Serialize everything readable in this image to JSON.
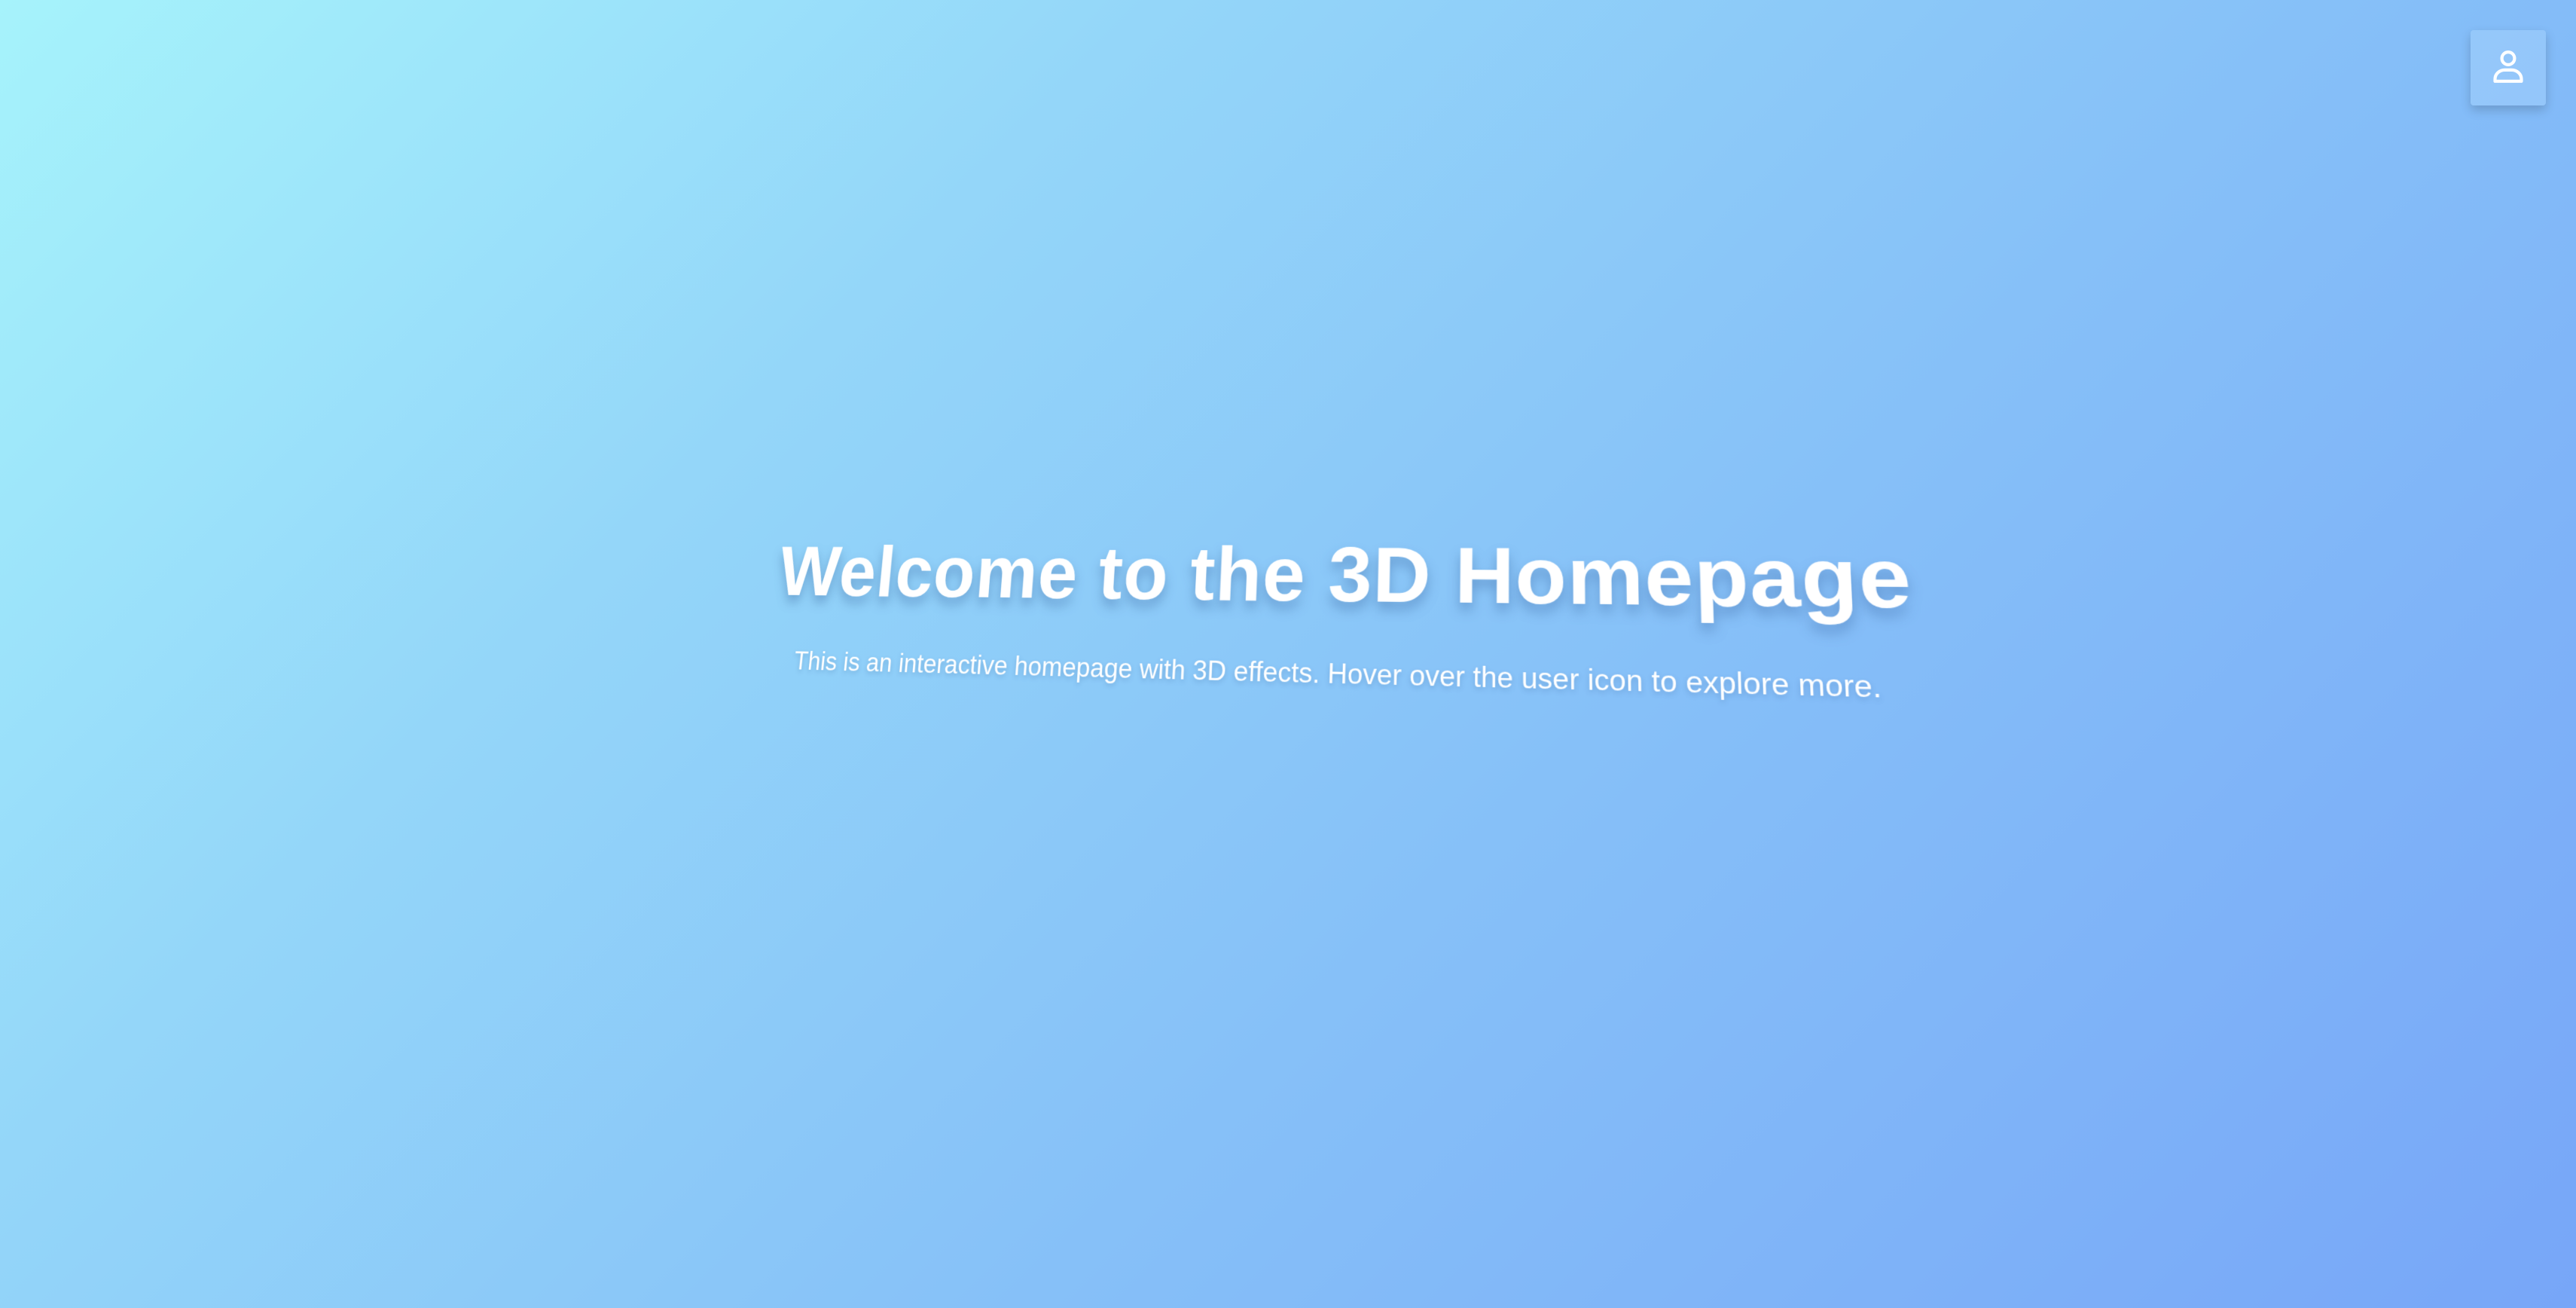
{
  "header": {
    "user_button": {
      "icon": "user-icon"
    }
  },
  "hero": {
    "title": "Welcome to the 3D Homepage",
    "subtitle": "This is an interactive homepage with 3D effects. Hover over the user icon to explore more."
  },
  "colors": {
    "gradient_start": "#a6f3fb",
    "gradient_end": "#77a6f8",
    "text": "#ffffff"
  }
}
